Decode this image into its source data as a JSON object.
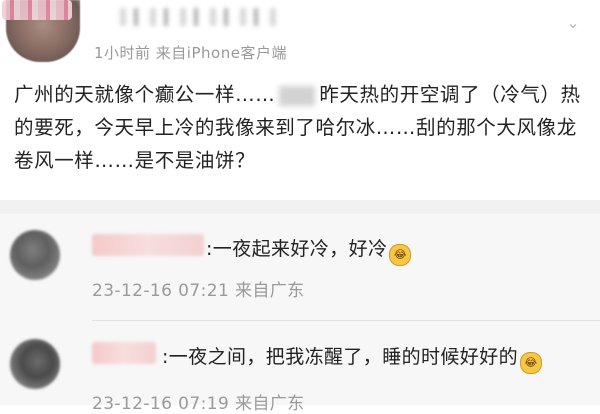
{
  "post": {
    "meta": "1小时前  来自iPhone客户端",
    "text_part1": "广州的天就像个癫公一样……",
    "text_part2": "昨天热的开空调了（冷气）热的要死，今天早上冷的我像来到了哈尔冰……刮的那个大风像龙卷风一样……是不是油饼？",
    "menu_icon": "chevron-down-icon"
  },
  "comments": [
    {
      "text": ":一夜起来好冷，好冷",
      "meta": "23-12-16 07:21 来自广东",
      "emoji_icon": "crying-laughing-icon"
    },
    {
      "text": ":一夜之间，把我冻醒了，睡的时候好好的",
      "meta": "23-12-16 07:19 来自广东",
      "emoji_icon": "crying-laughing-icon"
    }
  ],
  "colors": {
    "text": "#222222",
    "meta": "#999999",
    "comment_bg": "#f7f7f7",
    "divider": "#e3e3e3"
  }
}
